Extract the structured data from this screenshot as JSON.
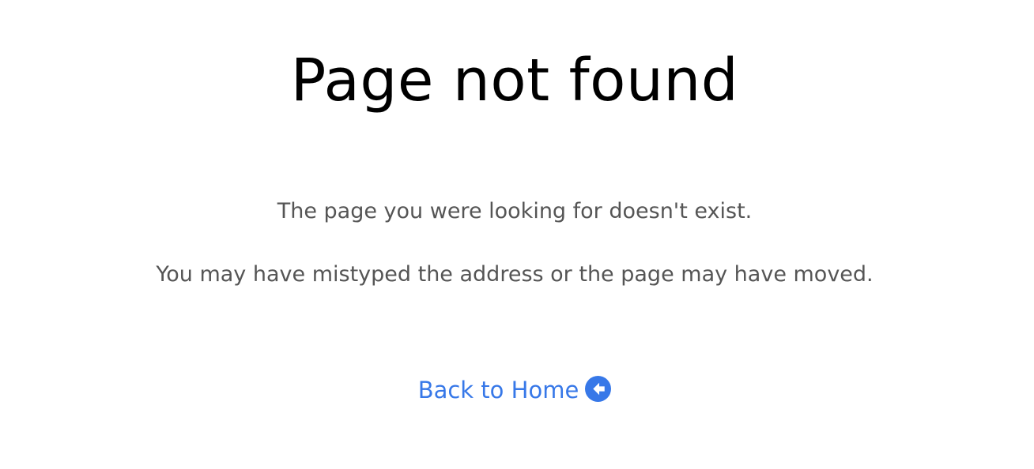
{
  "main": {
    "title": "Page not found",
    "message_line_1": "The page you were looking for doesn't exist.",
    "message_line_2": "You may have mistyped the address or the page may have moved.",
    "home_link": {
      "label": "Back to Home",
      "icon": "circle-arrow-left-icon"
    }
  },
  "colors": {
    "title": "#000000",
    "body_text": "#555555",
    "link": "#3778e8",
    "background": "#ffffff"
  }
}
